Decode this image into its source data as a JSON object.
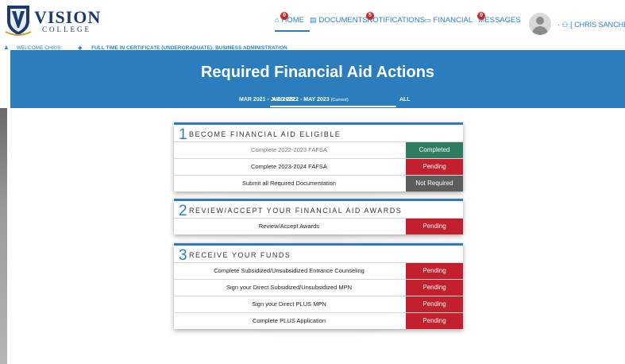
{
  "header": {
    "logo_text": "VISION",
    "logo_sub": "COLLEGE",
    "nav": [
      {
        "label": "HOME",
        "icon": "home-icon",
        "badge": "0"
      },
      {
        "label": "DOCUMENTS",
        "icon": "document-icon",
        "badge": ""
      },
      {
        "label": "NOTIFICATIONS",
        "icon": "bell-icon",
        "badge": "5"
      },
      {
        "label": "FINANCIAL",
        "icon": "card-icon",
        "badge": ""
      },
      {
        "label": "MESSAGES",
        "icon": "message-icon",
        "badge": "0"
      }
    ],
    "user_label": "[ CHRIS SANCHEZ ]",
    "welcome": "WELCOME CHRIS",
    "program": "FULL TIME IN CERTIFICATE (UNDERGRADUATE): BUSINESS ADMINISTRATION"
  },
  "banner": {
    "title": "Required Financial Aid Actions",
    "terms": [
      {
        "label": "MAR 2021 - JUL 2022",
        "current": ""
      },
      {
        "label": "AUG 2022 - MAY 2023",
        "current": "(Current)"
      },
      {
        "label": "ALL",
        "current": ""
      }
    ]
  },
  "steps": [
    {
      "number": "1",
      "title": "BECOME FINANCIAL AID ELIGIBLE",
      "rows": [
        {
          "label": "Complete 2022-2023 FAFSA",
          "status": "Completed"
        },
        {
          "label": "Complete 2023-2024 FAFSA",
          "status": "Pending"
        },
        {
          "label": "Submit all Required Documentation",
          "status": "Not Required"
        }
      ]
    },
    {
      "number": "2",
      "title": "REVIEW/ACCEPT YOUR FINANCIAL AID AWARDS",
      "rows": [
        {
          "label": "Review/Accept Awards",
          "status": "Pending"
        }
      ]
    },
    {
      "number": "3",
      "title": "RECEIVE YOUR FUNDS",
      "rows": [
        {
          "label": "Complete Subsidized/Unsubsidized Entrance Counseling",
          "status": "Pending"
        },
        {
          "label": "Sign your Direct Subsidized/Unsubsidized MPN",
          "status": "Pending"
        },
        {
          "label": "Sign your Direct PLUS MPN",
          "status": "Pending"
        },
        {
          "label": "Complete PLUS Application",
          "status": "Pending"
        }
      ]
    }
  ],
  "colors": {
    "brand_blue": "#2b7dbd",
    "completed": "#2f7d60",
    "pending": "#c41f2c",
    "not_required": "#5d5d5d"
  }
}
